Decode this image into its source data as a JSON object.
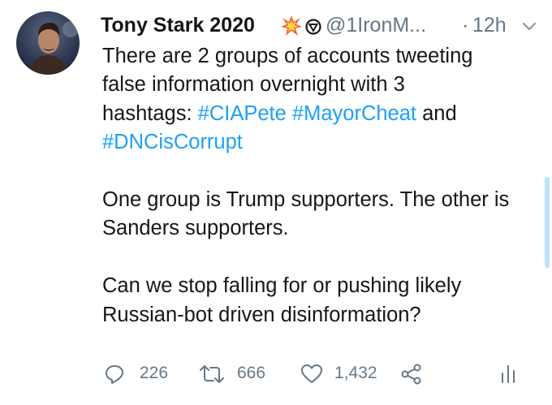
{
  "author": {
    "name": "Tony Stark 2020",
    "handle": "@1IronM...",
    "separator": "·",
    "time": "12h",
    "badge_icons": [
      "collision-emoji-icon",
      "shield-emblem-icon"
    ]
  },
  "tweet": {
    "line1": "There are 2 groups of accounts tweeting",
    "line2": "false information overnight with 3",
    "line3_prefix": "hashtags: ",
    "hashtag1": "#CIAPete",
    "hashtag2": "#MayorCheat",
    "and_word": "and",
    "hashtag3": "#DNCisCorrupt",
    "paragraph2": "One group is Trump supporters. The other is Sanders supporters.",
    "paragraph3": "Can we stop falling for or pushing likely Russian-bot driven disinformation?"
  },
  "actions": {
    "replies": "226",
    "retweets": "666",
    "likes": "1,432"
  },
  "colors": {
    "text": "#14171a",
    "secondary": "#657786",
    "link": "#1da1f2"
  }
}
